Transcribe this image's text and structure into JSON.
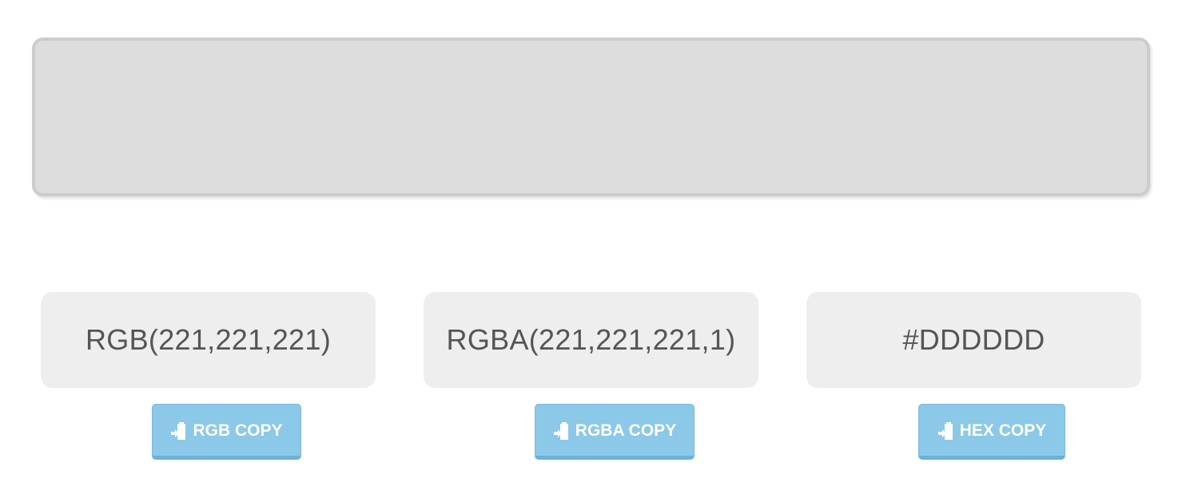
{
  "swatch": {
    "color": "#DDDDDD",
    "border_color": "#CCCCCC"
  },
  "values": {
    "rgb": "RGB(221,221,221)",
    "rgba": "RGBA(221,221,221,1)",
    "hex": "#DDDDDD"
  },
  "buttons": {
    "rgb_copy": "RGB COPY",
    "rgba_copy": "RGBA COPY",
    "hex_copy": "HEX COPY",
    "icon": "clipboard-paste-icon",
    "color": "#8CC8E8"
  }
}
